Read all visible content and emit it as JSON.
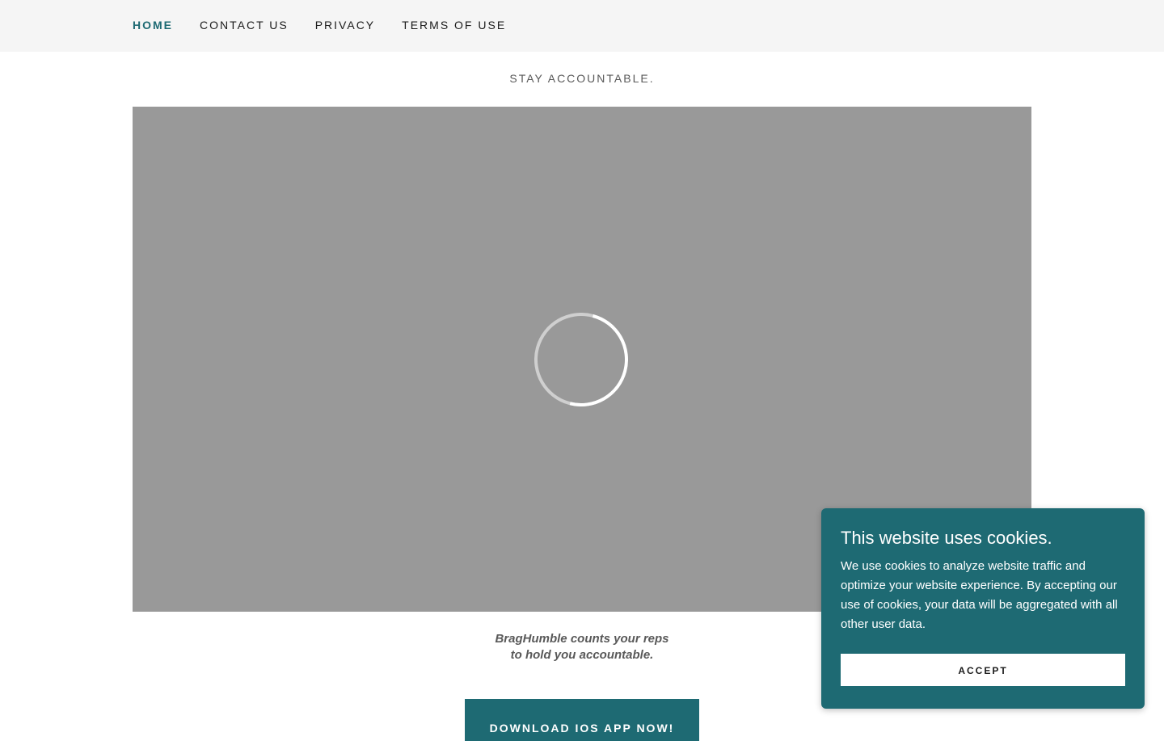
{
  "nav": {
    "items": [
      {
        "label": "HOME",
        "active": true
      },
      {
        "label": "CONTACT US",
        "active": false
      },
      {
        "label": "PRIVACY",
        "active": false
      },
      {
        "label": "TERMS OF USE",
        "active": false
      }
    ]
  },
  "hero": {
    "tagline": "STAY ACCOUNTABLE.",
    "video_state": "loading",
    "spinner_icon": "loading-spinner-icon"
  },
  "caption": {
    "line1": "BragHumble counts your reps",
    "line2": "to hold you accountable."
  },
  "cta": {
    "download_label": "DOWNLOAD IOS APP NOW!"
  },
  "cookie_banner": {
    "title": "This website uses cookies.",
    "body": "We use cookies to analyze website traffic and optimize your website experience. By accepting our use of cookies, your data will be aggregated with all other user data.",
    "accept_label": "ACCEPT"
  },
  "colors": {
    "accent": "#1e6a73",
    "nav_background": "#f5f5f5",
    "video_placeholder": "#999999",
    "text_muted": "#595959"
  }
}
